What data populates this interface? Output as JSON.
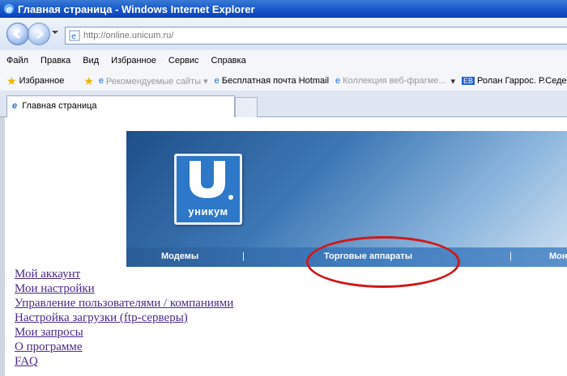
{
  "window": {
    "title": "Главная страница - Windows Internet Explorer"
  },
  "address": {
    "url": "http://online.unicum.ru/"
  },
  "menu": [
    "Файл",
    "Правка",
    "Вид",
    "Избранное",
    "Сервис",
    "Справка"
  ],
  "favorites": {
    "label": "Избранное",
    "items": [
      {
        "label": "Рекомендуемые сайты ▾",
        "muted": true
      },
      {
        "label": "Бесплатная почта Hotmail",
        "muted": false
      },
      {
        "label": "Коллекция веб-фрагме...",
        "muted": true
      },
      {
        "label": "Ролан Гаррос. Р.Седер",
        "muted": false
      }
    ]
  },
  "tab": {
    "title": "Главная страница"
  },
  "banner": {
    "logo_text": "уникум",
    "nav": [
      "Модемы",
      "|",
      "Торговые аппараты",
      "|",
      "Мон"
    ]
  },
  "links": [
    "Мой аккаунт",
    "Мои настройки",
    "Управление пользователями / компаниями",
    "Настройка загрузки (ftp-серверы)",
    "Мои запросы",
    "О программе",
    "FAQ"
  ],
  "colors": {
    "titlebar": "#1f5fcf",
    "link": "#4b2a8a",
    "annotation_circle": "#d01818"
  }
}
